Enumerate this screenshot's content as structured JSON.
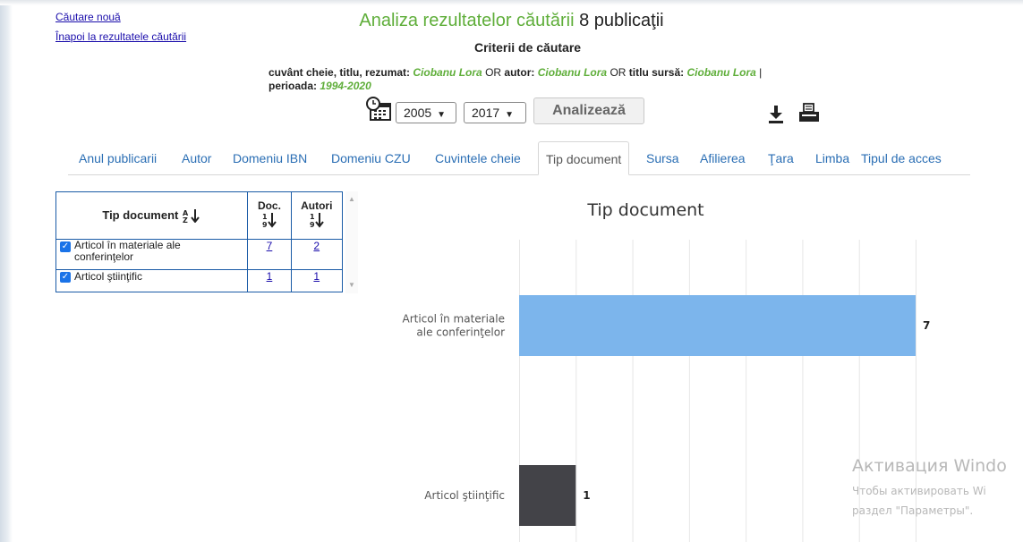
{
  "links": {
    "new_search": "Căutare nouă",
    "back_results": "Înapoi la rezultatele căutării"
  },
  "header": {
    "title": "Analiza rezultatelor căutării",
    "count": "8 publicaţii",
    "criteria_title": "Criterii de căutare"
  },
  "criteria": {
    "k1": "cuvânt cheie, titlu, rezumat:",
    "v1": "Ciobanu Lora",
    "or1": "OR",
    "k2": "autor:",
    "v2": "Ciobanu Lora",
    "or2": "OR",
    "k3": "titlu sursă:",
    "v3": "Ciobanu Lora",
    "sep": "|",
    "k4": "perioada:",
    "v4": "1994-2020"
  },
  "controls": {
    "year_from": "2005",
    "year_to": "2017",
    "analyze_label": "Analizează"
  },
  "tabs": [
    {
      "label": "Anul publicarii"
    },
    {
      "label": "Autor"
    },
    {
      "label": "Domeniu IBN"
    },
    {
      "label": "Domeniu CZU"
    },
    {
      "label": "Cuvintele cheie"
    },
    {
      "label": "Tip document"
    },
    {
      "label": "Sursa"
    },
    {
      "label": "Afilierea"
    },
    {
      "label": "Ţara"
    },
    {
      "label": "Limba"
    },
    {
      "label": "Tipul de acces"
    }
  ],
  "table": {
    "col_type": "Tip document",
    "col_doc": "Doc.",
    "col_authors": "Autori",
    "rows": [
      {
        "name": "Articol în materiale ale conferinţelor",
        "doc": "7",
        "authors": "2"
      },
      {
        "name": "Articol ştiinţific",
        "doc": "1",
        "authors": "1"
      }
    ]
  },
  "chart_data": {
    "type": "bar",
    "orientation": "horizontal",
    "title": "Tip document",
    "categories": [
      "Articol în materiale ale conferinţelor",
      "Articol ştiinţific"
    ],
    "values": [
      7,
      1
    ],
    "colors": [
      "#7cb5ec",
      "#434348"
    ],
    "xlim": [
      0,
      7
    ],
    "grid": true
  },
  "watermark": {
    "line1": "Активация Windo",
    "line2": "Чтобы активировать Wi",
    "line3": "раздел \"Параметры\"."
  }
}
